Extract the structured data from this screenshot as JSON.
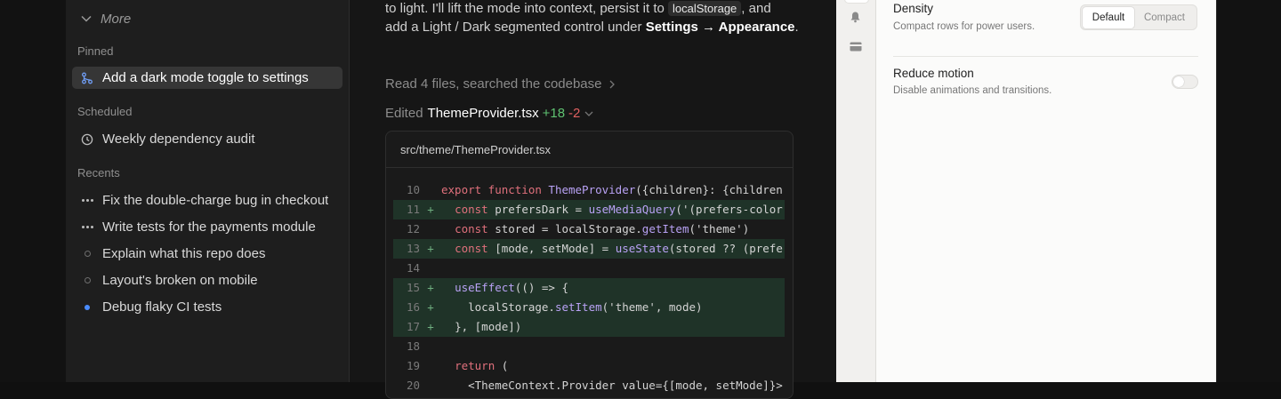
{
  "sidebar": {
    "more_label": "More",
    "pinned_label": "Pinned",
    "pinned_items": [
      {
        "label": "Add a dark mode toggle to settings",
        "icon": "branch-icon",
        "active": true
      }
    ],
    "scheduled_label": "Scheduled",
    "scheduled_items": [
      {
        "label": "Weekly dependency audit",
        "icon": "clock-icon"
      }
    ],
    "recents_label": "Recents",
    "recent_items": [
      {
        "label": "Fix the double-charge bug in checkout",
        "icon": "running-dots-icon"
      },
      {
        "label": "Write tests for the payments module",
        "icon": "running-dots-icon"
      },
      {
        "label": "Explain what this repo does",
        "icon": "idle-circle-icon"
      },
      {
        "label": "Layout's broken on mobile",
        "icon": "idle-circle-icon"
      },
      {
        "label": "Debug flaky CI tests",
        "icon": "unread-dot-icon"
      }
    ]
  },
  "chat": {
    "message": {
      "line1_prefix": "to light. I'll lift the mode into context, persist it to ",
      "line1_code": "localStorage",
      "line1_suffix": ", and",
      "line2_prefix": "add a Light / Dark segmented control under ",
      "line2_bold": "Settings → Appearance",
      "line2_suffix": "."
    },
    "activity_summary": "Read 4 files, searched the codebase",
    "edit": {
      "prefix": "Edited",
      "filename": "ThemeProvider.tsx",
      "additions": "+18",
      "deletions": "-2"
    },
    "code": {
      "path": "src/theme/ThemeProvider.tsx",
      "lines": [
        {
          "num": "10",
          "marker": "",
          "added": false
        },
        {
          "num": "11",
          "marker": "+",
          "added": true
        },
        {
          "num": "12",
          "marker": "",
          "added": false
        },
        {
          "num": "13",
          "marker": "+",
          "added": true
        },
        {
          "num": "14",
          "marker": "",
          "added": false
        },
        {
          "num": "15",
          "marker": "+",
          "added": true
        },
        {
          "num": "16",
          "marker": "+",
          "added": true
        },
        {
          "num": "17",
          "marker": "+",
          "added": true
        },
        {
          "num": "18",
          "marker": "",
          "added": false
        },
        {
          "num": "19",
          "marker": "",
          "added": false
        },
        {
          "num": "20",
          "marker": "",
          "added": false
        }
      ],
      "tokens": {
        "l10_kw": "export function ",
        "l10_fn": "ThemeProvider",
        "l10_rest": "({children}: {children",
        "l11_kw": "const ",
        "l11_mid": "prefersDark = ",
        "l11_fn": "useMediaQuery",
        "l11_rest": "('(prefers-color-",
        "l12_kw": "const ",
        "l12_mid": "stored = localStorage.",
        "l12_fn": "getItem",
        "l12_rest": "('theme')",
        "l13_kw": "const ",
        "l13_mid": "[mode, setMode] = ",
        "l13_fn": "useState",
        "l13_rest": "(stored ?? (prefe",
        "l15_fn": "useEffect",
        "l15_rest": "(() => {",
        "l16_mid": "localStorage.",
        "l16_fn": "setItem",
        "l16_rest": "('theme', mode)",
        "l17_rest": "}, [mode])",
        "l19_kw": "return",
        "l19_rest": " (",
        "l20_rest": "<ThemeContext.Provider value={[mode, setMode]}>"
      }
    }
  },
  "settings": {
    "density": {
      "title": "Density",
      "description": "Compact rows for power users.",
      "options": [
        "Default",
        "Compact"
      ],
      "selected": "Default"
    },
    "reduce_motion": {
      "title": "Reduce motion",
      "description": "Disable animations and transitions.",
      "enabled": false
    }
  },
  "rail_icons": [
    "bell-icon",
    "card-icon"
  ]
}
